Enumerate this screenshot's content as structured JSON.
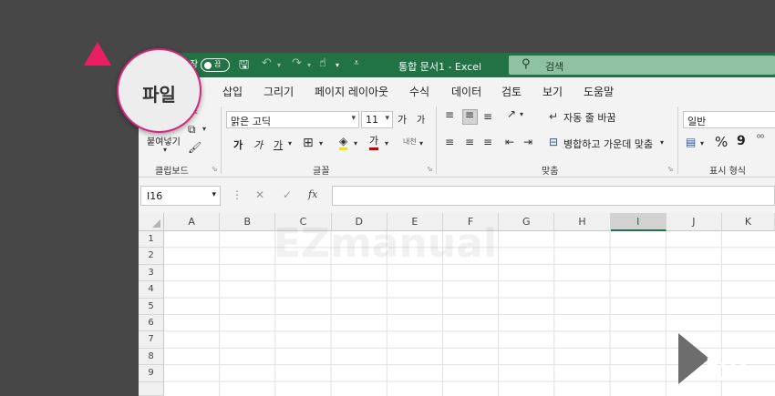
{
  "window": {
    "autosave_label": "장",
    "toggle_label": "끔",
    "doc_title": "통합 문서1  -  Excel",
    "search_placeholder": "검색"
  },
  "tabs": [
    "삽입",
    "그리기",
    "페이지 레이아웃",
    "수식",
    "데이터",
    "검토",
    "보기",
    "도움말"
  ],
  "callout": {
    "label": "파일"
  },
  "ribbon": {
    "clipboard": {
      "paste_label": "붙여넣기",
      "group_label": "클립보드"
    },
    "font": {
      "font_name": "맑은 고딕",
      "font_size": "11",
      "grow_label": "가",
      "shrink_label": "가",
      "bold": "가",
      "italic": "가",
      "underline": "가",
      "font_color_label": "가",
      "phonetic_label": "내천",
      "group_label": "글꼴"
    },
    "alignment": {
      "wrap_text": "자동 줄 바꿈",
      "merge_center": "병합하고 가운데 맞춤",
      "group_label": "맞춤"
    },
    "number": {
      "format": "일반",
      "percent": "%",
      "comma": "9",
      "group_label": "표시 형식"
    }
  },
  "formula_bar": {
    "name_box": "I16",
    "fx": "fx"
  },
  "grid": {
    "columns": [
      "A",
      "B",
      "C",
      "D",
      "E",
      "F",
      "G",
      "H",
      "I",
      "J",
      "K"
    ],
    "active_column": "I",
    "rows": [
      "1",
      "2",
      "3",
      "4",
      "5",
      "6",
      "7",
      "8",
      "9"
    ]
  },
  "watermark": "EZmanual",
  "logo": {
    "line1": "inside",
    "line2": "BOX",
    "line3": "EZmanual"
  },
  "colors": {
    "excel_green": "#217346",
    "callout_pink": "#ea1e63"
  }
}
